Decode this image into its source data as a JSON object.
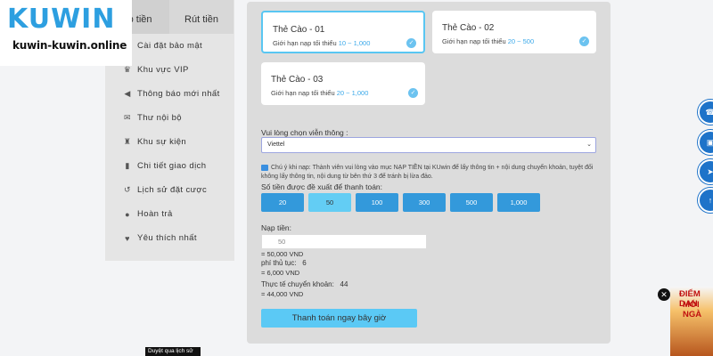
{
  "logo": {
    "mark": "KUWIN",
    "subtitle": "kuwin-kuwin.online"
  },
  "sidebar": {
    "tabs": [
      {
        "label": "ạp tiền"
      },
      {
        "label": "Rút tiền"
      }
    ],
    "items": [
      {
        "label": "Cài đặt bảo mật",
        "icon": "shield-icon"
      },
      {
        "label": "Khu vực VIP",
        "icon": "crown-icon"
      },
      {
        "label": "Thông báo mới nhất",
        "icon": "megaphone-icon"
      },
      {
        "label": "Thư nội bộ",
        "icon": "mail-icon"
      },
      {
        "label": "Khu sự kiện",
        "icon": "trophy-icon"
      },
      {
        "label": "Chi tiết giao dịch",
        "icon": "document-icon"
      },
      {
        "label": "Lịch sử đặt cược",
        "icon": "history-icon"
      },
      {
        "label": "Hoàn trả",
        "icon": "coin-icon"
      },
      {
        "label": "Yêu thích nhất",
        "icon": "heart-icon"
      }
    ]
  },
  "cards": [
    {
      "title": "Thẻ Cào - 01",
      "limit_prefix": "Giới hạn nạp tối thiểu ",
      "min": "10",
      "sep": " ~ ",
      "max": "1,000",
      "selected": true
    },
    {
      "title": "Thẻ Cào - 02",
      "limit_prefix": "Giới hạn nạp tối thiểu ",
      "min": "20",
      "sep": " ~ ",
      "max": "500",
      "selected": false
    },
    {
      "title": "Thẻ Cào - 03",
      "limit_prefix": "Giới hạn nạp tối thiểu ",
      "min": "20",
      "sep": " ~ ",
      "max": "1,000",
      "selected": false
    }
  ],
  "carrier": {
    "label": "Vui lòng chọn viễn thông :",
    "value": "Viettel"
  },
  "note": "Chú ý khi nạp: Thành viên vui lòng vào mục NẠP TIỀN tại KUwin để lấy thông tin + nội dung chuyển khoản, tuyệt đối không lấy thông tin, nội dung từ bên thứ 3 để tránh bị lừa đảo.",
  "amounts": {
    "label": "Số tiền được đề xuất để thanh toán:",
    "options": [
      "20",
      "50",
      "100",
      "300",
      "500",
      "1,000"
    ],
    "selected_index": 1
  },
  "deposit": {
    "label": "Nạp tiền:",
    "value": "50",
    "equals": "= 50,000 VND",
    "fee_label": "phí thủ tục:",
    "fee_value": "6",
    "fee_equals": "= 6,000 VND",
    "actual_label": "Thực tế chuyển khoản:",
    "actual_value": "44",
    "actual_equals": "= 44,000 VND"
  },
  "pay_button": "Thanh toán ngay bây giờ",
  "promo": {
    "line1": "ĐIỂM DAN",
    "line2": "MỚI NGÀ"
  },
  "tooltip": "Duyệt qua lịch sử",
  "colors": {
    "accent": "#3399db",
    "highlight": "#63cdf4",
    "brand": "#2d9fe0"
  }
}
